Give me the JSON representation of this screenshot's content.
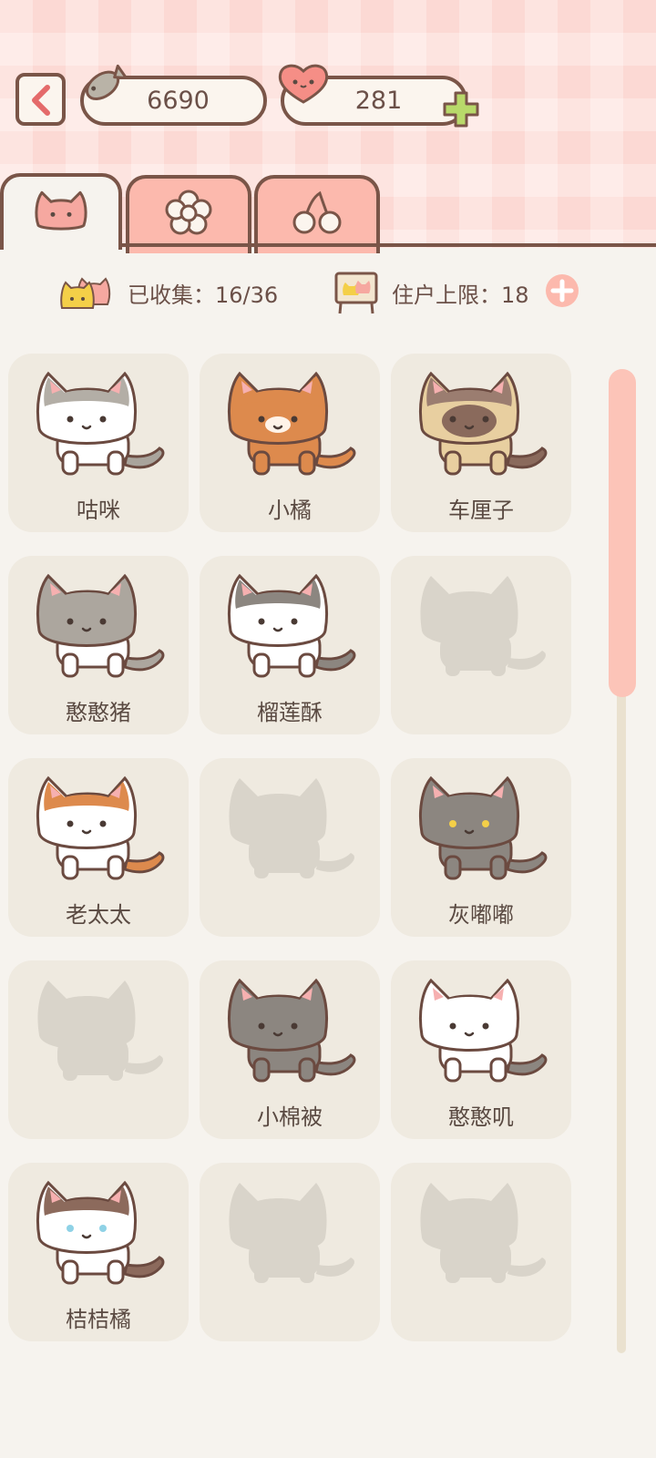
{
  "currency": {
    "fish": "6690",
    "hearts": "281"
  },
  "icons": {
    "back": "chevron-left-icon",
    "fish": "fish-icon",
    "heart": "heart-icon",
    "add_hearts": "plus-icon",
    "tab_cats": "cat-face-icon",
    "tab_flower": "flower-icon",
    "tab_cherry": "cherry-icon"
  },
  "tabs": [
    {
      "id": "cats",
      "active": true
    },
    {
      "id": "flower",
      "active": false
    },
    {
      "id": "cherry",
      "active": false
    }
  ],
  "stats": {
    "collected_label": "已收集：",
    "collected_value": "16/36",
    "limit_label": "住户上限：",
    "limit_value": "18"
  },
  "cats": [
    {
      "name": "咕咪",
      "unlocked": true
    },
    {
      "name": "小橘",
      "unlocked": true
    },
    {
      "name": "车厘子",
      "unlocked": true
    },
    {
      "name": "憨憨猪",
      "unlocked": true
    },
    {
      "name": "榴莲酥",
      "unlocked": true
    },
    {
      "name": "",
      "unlocked": false
    },
    {
      "name": "老太太",
      "unlocked": true
    },
    {
      "name": "",
      "unlocked": false
    },
    {
      "name": "灰嘟嘟",
      "unlocked": true
    },
    {
      "name": "",
      "unlocked": false
    },
    {
      "name": "小棉被",
      "unlocked": true
    },
    {
      "name": "憨憨叽",
      "unlocked": true
    },
    {
      "name": "桔桔橘",
      "unlocked": true
    },
    {
      "name": "",
      "unlocked": false
    },
    {
      "name": "",
      "unlocked": false
    }
  ],
  "colors": {
    "accent": "#fcb9ad",
    "outline": "#7a5548",
    "card": "#efeae0",
    "plus": "#b8d96a"
  }
}
